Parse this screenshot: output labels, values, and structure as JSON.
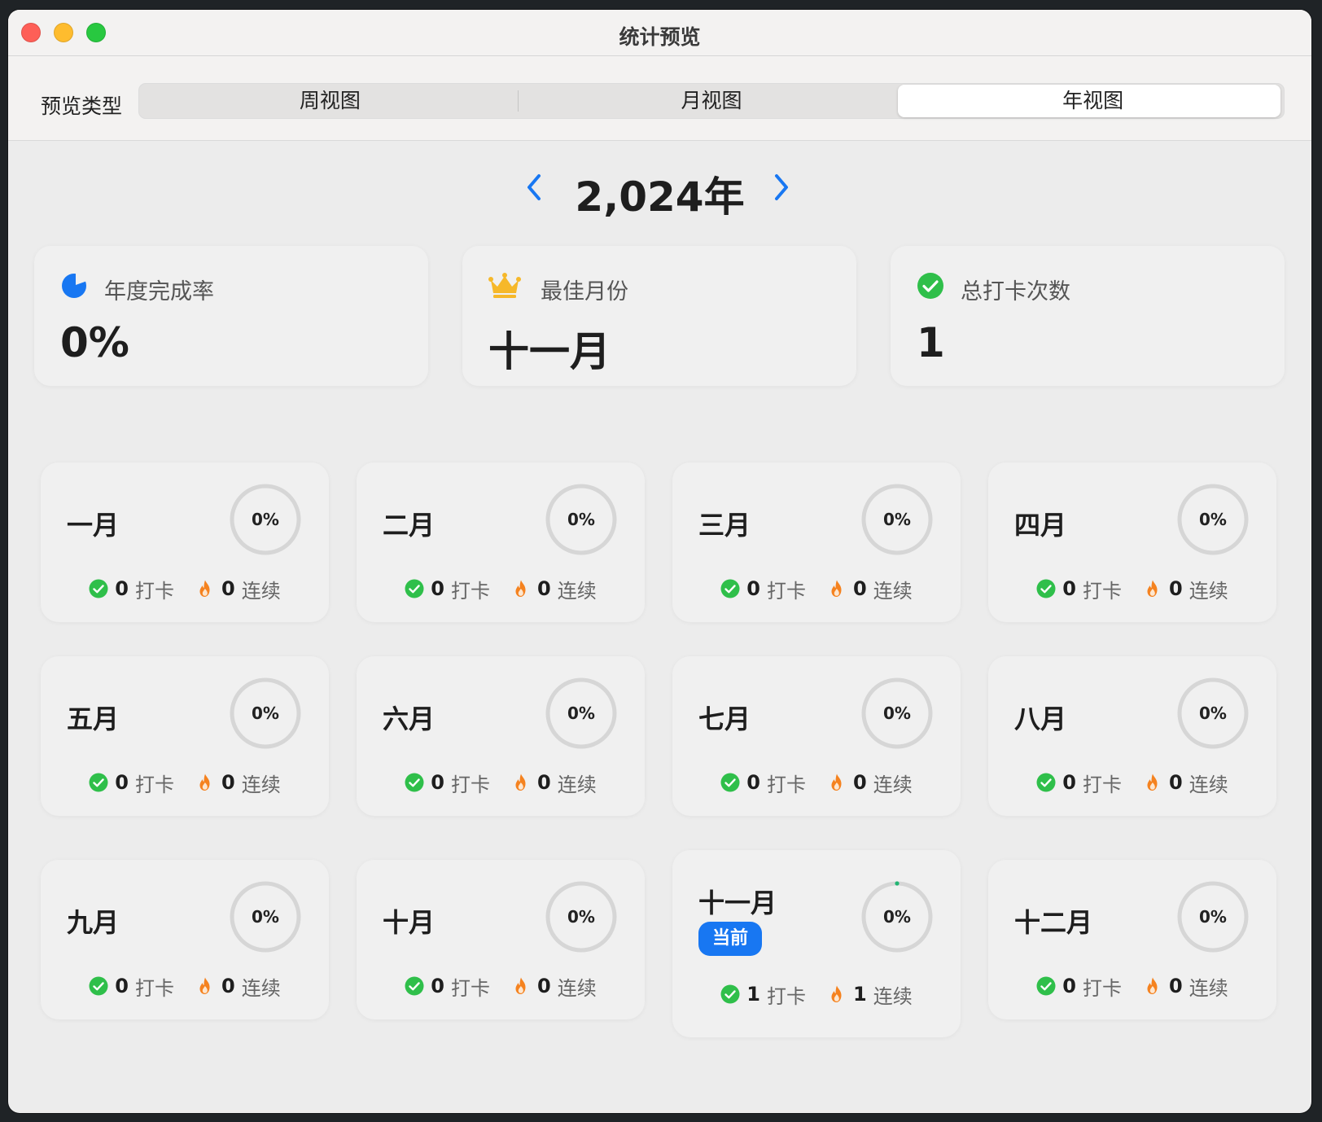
{
  "window": {
    "title": "统计预览"
  },
  "toolbar": {
    "preview_label": "预览类型",
    "tabs": [
      {
        "label": "周视图"
      },
      {
        "label": "月视图"
      },
      {
        "label": "年视图"
      }
    ],
    "selected": "年视图"
  },
  "year_nav": {
    "year": "2,024年",
    "prev_icon": "chevron-left-icon",
    "next_icon": "chevron-right-icon"
  },
  "stats": [
    {
      "label": "年度完成率",
      "value": "0%",
      "icon": "pie-chart-icon"
    },
    {
      "label": "最佳月份",
      "value": "十一月",
      "icon": "crown-icon"
    },
    {
      "label": "总打卡次数",
      "value": "1",
      "icon": "check-circle-icon"
    }
  ],
  "months": [
    {
      "name": "一月",
      "percent": "0%",
      "checkins": "0",
      "checkin_label": "打卡",
      "streak": "0",
      "streak_label": "连续"
    },
    {
      "name": "二月",
      "percent": "0%",
      "checkins": "0",
      "checkin_label": "打卡",
      "streak": "0",
      "streak_label": "连续"
    },
    {
      "name": "三月",
      "percent": "0%",
      "checkins": "0",
      "checkin_label": "打卡",
      "streak": "0",
      "streak_label": "连续"
    },
    {
      "name": "四月",
      "percent": "0%",
      "checkins": "0",
      "checkin_label": "打卡",
      "streak": "0",
      "streak_label": "连续"
    },
    {
      "name": "五月",
      "percent": "0%",
      "checkins": "0",
      "checkin_label": "打卡",
      "streak": "0",
      "streak_label": "连续"
    },
    {
      "name": "六月",
      "percent": "0%",
      "checkins": "0",
      "checkin_label": "打卡",
      "streak": "0",
      "streak_label": "连续"
    },
    {
      "name": "七月",
      "percent": "0%",
      "checkins": "0",
      "checkin_label": "打卡",
      "streak": "0",
      "streak_label": "连续"
    },
    {
      "name": "八月",
      "percent": "0%",
      "checkins": "0",
      "checkin_label": "打卡",
      "streak": "0",
      "streak_label": "连续"
    },
    {
      "name": "九月",
      "percent": "0%",
      "checkins": "0",
      "checkin_label": "打卡",
      "streak": "0",
      "streak_label": "连续"
    },
    {
      "name": "十月",
      "percent": "0%",
      "checkins": "0",
      "checkin_label": "打卡",
      "streak": "0",
      "streak_label": "连续"
    },
    {
      "name": "十一月",
      "percent": "0%",
      "checkins": "1",
      "checkin_label": "打卡",
      "streak": "1",
      "streak_label": "连续",
      "badge": "当前"
    },
    {
      "name": "十二月",
      "percent": "0%",
      "checkins": "0",
      "checkin_label": "打卡",
      "streak": "0",
      "streak_label": "连续"
    }
  ],
  "colors": {
    "accent": "#1877f2",
    "check": "#2fbf4a",
    "flame": "#f5821f",
    "crown": "#f6b82a",
    "ring": "#d6d6d6",
    "progress": "#22b573"
  }
}
